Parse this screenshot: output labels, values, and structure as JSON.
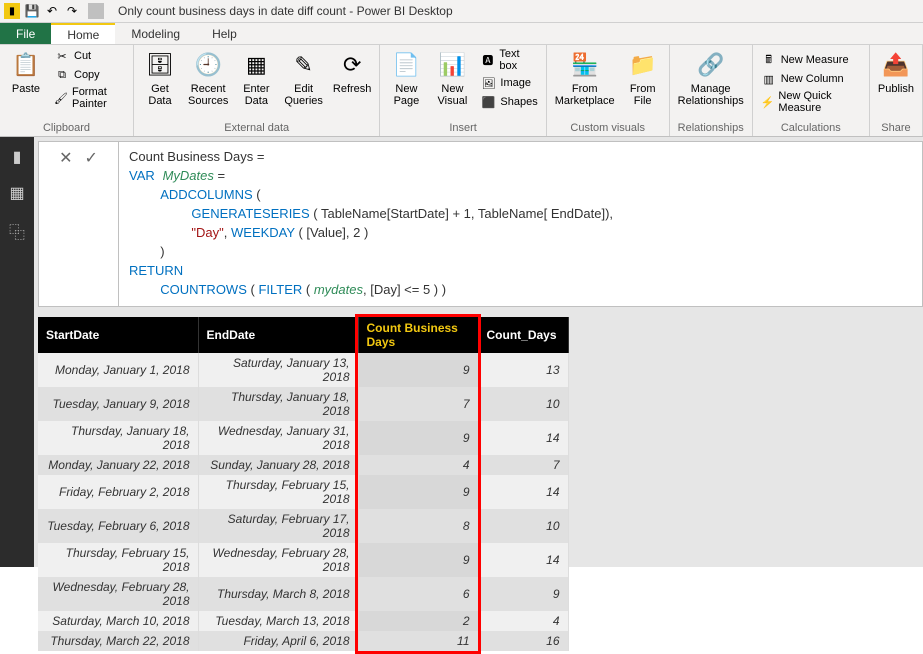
{
  "titlebar": {
    "title": "Only count business days in date diff count - Power BI Desktop"
  },
  "tabs": {
    "file": "File",
    "home": "Home",
    "modeling": "Modeling",
    "help": "Help"
  },
  "ribbon": {
    "clipboard": {
      "label": "Clipboard",
      "paste": "Paste",
      "cut": "Cut",
      "copy": "Copy",
      "format_painter": "Format Painter"
    },
    "external": {
      "label": "External data",
      "get_data": "Get\nData",
      "recent_sources": "Recent\nSources",
      "enter_data": "Enter\nData",
      "edit_queries": "Edit\nQueries",
      "refresh": "Refresh"
    },
    "insert": {
      "label": "Insert",
      "new_page": "New\nPage",
      "new_visual": "New\nVisual",
      "text_box": "Text box",
      "image": "Image",
      "shapes": "Shapes"
    },
    "custom": {
      "label": "Custom visuals",
      "from_marketplace": "From\nMarketplace",
      "from_file": "From\nFile"
    },
    "relationships": {
      "label": "Relationships",
      "manage": "Manage\nRelationships"
    },
    "calculations": {
      "label": "Calculations",
      "new_measure": "New Measure",
      "new_column": "New Column",
      "new_quick_measure": "New Quick Measure"
    },
    "share": {
      "label": "Share",
      "publish": "Publish"
    }
  },
  "formula": {
    "line1_a": "Count Business Days =",
    "line2_a": "VAR",
    "line2_b": "MyDates",
    "line2_c": " =",
    "line3_a": "ADDCOLUMNS",
    "line3_b": " (",
    "line4_a": "GENERATESERIES",
    "line4_b": " ( TableName[StartDate] + 1, TableName[ EndDate]),",
    "line5_a": "\"Day\"",
    "line5_b": ", ",
    "line5_c": "WEEKDAY",
    "line5_d": " ( [Value], 2 )",
    "line6_a": ")",
    "line7_a": "RETURN",
    "line8_a": "COUNTROWS",
    "line8_b": " ( ",
    "line8_c": "FILTER",
    "line8_d": " ( ",
    "line8_e": "mydates",
    "line8_f": ", [Day] <= 5 ) )"
  },
  "table": {
    "headers": [
      "StartDate",
      "EndDate",
      "Count Business Days",
      "Count_Days"
    ],
    "rows": [
      [
        "Monday, January 1, 2018",
        "Saturday, January 13, 2018",
        "9",
        "13"
      ],
      [
        "Tuesday, January 9, 2018",
        "Thursday, January 18, 2018",
        "7",
        "10"
      ],
      [
        "Thursday, January 18, 2018",
        "Wednesday, January 31, 2018",
        "9",
        "14"
      ],
      [
        "Monday, January 22, 2018",
        "Sunday, January 28, 2018",
        "4",
        "7"
      ],
      [
        "Friday, February 2, 2018",
        "Thursday, February 15, 2018",
        "9",
        "14"
      ],
      [
        "Tuesday, February 6, 2018",
        "Saturday, February 17, 2018",
        "8",
        "10"
      ],
      [
        "Thursday, February 15, 2018",
        "Wednesday, February 28, 2018",
        "9",
        "14"
      ],
      [
        "Wednesday, February 28, 2018",
        "Thursday, March 8, 2018",
        "6",
        "9"
      ],
      [
        "Saturday, March 10, 2018",
        "Tuesday, March 13, 2018",
        "2",
        "4"
      ],
      [
        "Thursday, March 22, 2018",
        "Friday, April 6, 2018",
        "11",
        "16"
      ]
    ]
  }
}
